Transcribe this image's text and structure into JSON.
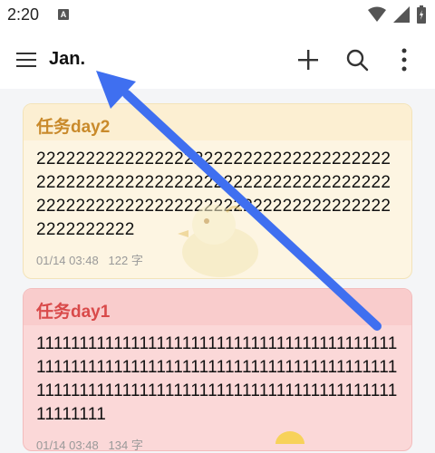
{
  "status_bar": {
    "time": "2:20",
    "notification_letter": "A"
  },
  "app_bar": {
    "title": "Jan."
  },
  "notes": [
    {
      "title": "任务day2",
      "content": "2222222222222222222222222222222222222222222222222222222222222222222222222222222222222222222222222222222222222222222222",
      "date": "01/14 03:48",
      "count": "122 字",
      "colors": {
        "title": "#c98a2b",
        "background": "#fdf5e2"
      }
    },
    {
      "title": "任务day1",
      "content": "11111111111111111111111111111111111111111111111111111111111111111111111111111111111111111111111111111111111111111111111111111111111111",
      "date": "01/14 03:48",
      "count": "134 字",
      "colors": {
        "title": "#d94a4a",
        "background": "#fbd8d8"
      }
    }
  ],
  "colors": {
    "arrow": "#3f6ff0"
  }
}
